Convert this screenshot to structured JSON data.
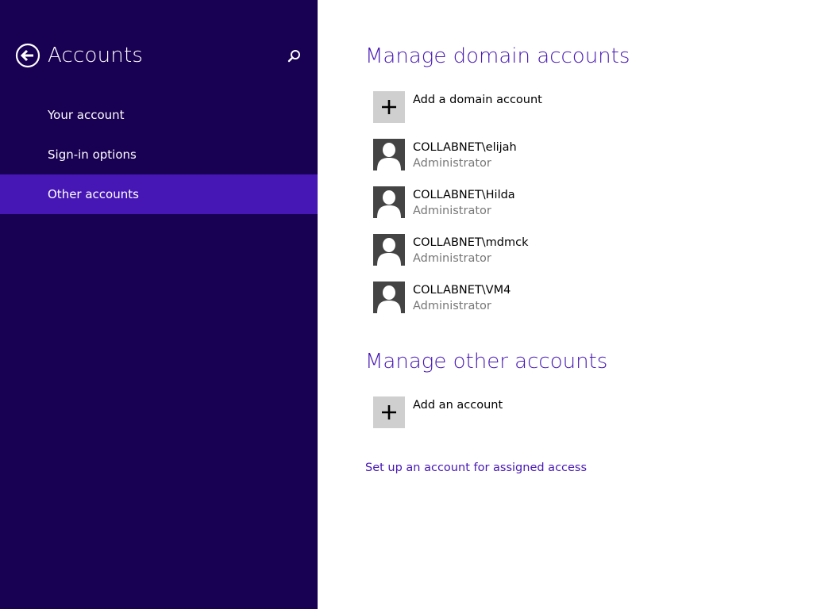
{
  "header": {
    "title": "Accounts",
    "back_icon": "back-arrow-icon",
    "search_icon": "search-icon"
  },
  "sidebar": {
    "items": [
      {
        "label": "Your account",
        "selected": false
      },
      {
        "label": "Sign-in options",
        "selected": false
      },
      {
        "label": "Other accounts",
        "selected": true
      }
    ]
  },
  "domain_section": {
    "title": "Manage domain accounts",
    "add_label": "Add a domain account",
    "accounts": [
      {
        "name": "COLLABNET\\elijah",
        "role": "Administrator"
      },
      {
        "name": "COLLABNET\\Hilda",
        "role": "Administrator"
      },
      {
        "name": "COLLABNET\\mdmck",
        "role": "Administrator"
      },
      {
        "name": "COLLABNET\\VM4",
        "role": "Administrator"
      }
    ]
  },
  "other_section": {
    "title": "Manage other accounts",
    "add_label": "Add an account"
  },
  "assigned_access_link": "Set up an account for assigned access",
  "colors": {
    "sidebar_bg": "#180052",
    "accent": "#4617b4",
    "secondary_text": "#777777",
    "tile_add_bg": "#cfcfcf",
    "tile_user_bg": "#444444"
  }
}
